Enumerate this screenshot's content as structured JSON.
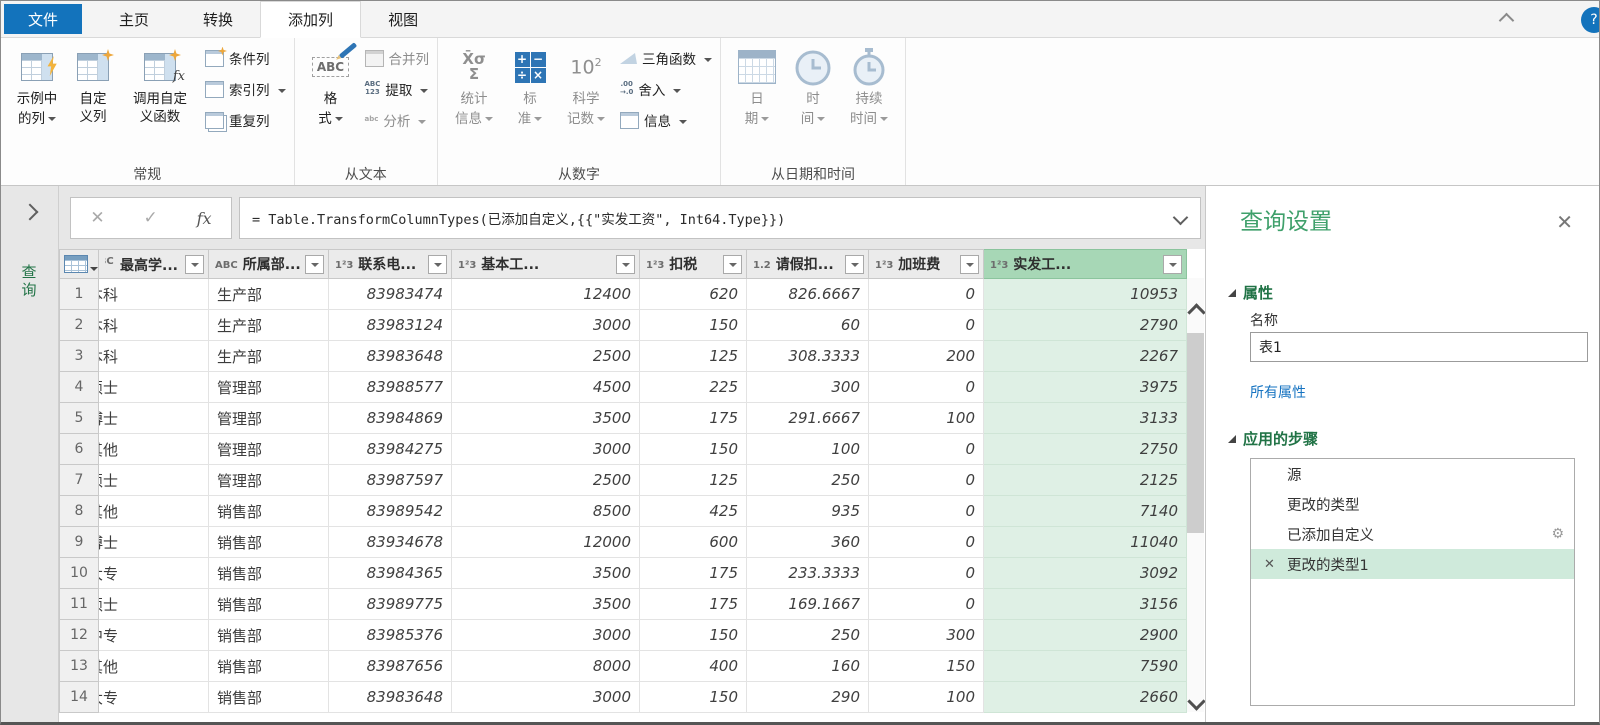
{
  "colors": {
    "tab_blue": "#1373bc",
    "panel_title_green": "#3fa06b",
    "heading_green": "#217346",
    "selected_column_header": "#a7d7b6",
    "selected_column_cell": "#dff0e5",
    "step_selected_bg": "#cfeadb",
    "link_blue": "#1673c1"
  },
  "tabs": [
    {
      "label": "文件"
    },
    {
      "label": "主页"
    },
    {
      "label": "转换"
    },
    {
      "label": "添加列"
    },
    {
      "label": "视图"
    }
  ],
  "ribbon": {
    "groups": [
      {
        "name": "常规",
        "big": [
          {
            "label": "示例中\n的列",
            "arrow": true
          },
          {
            "label": "自定\n义列",
            "arrow": false
          },
          {
            "label": "调用自定\n义函数",
            "arrow": false
          }
        ],
        "small": [
          {
            "label": "条件列",
            "arrow": false
          },
          {
            "label": "索引列",
            "arrow": true
          },
          {
            "label": "重复列",
            "arrow": false
          }
        ]
      },
      {
        "name": "从文本",
        "big": [
          {
            "label": "格\n式",
            "arrow": true
          }
        ],
        "small": [
          {
            "label": "合并列",
            "arrow": false,
            "disabled": true
          },
          {
            "label": "提取",
            "arrow": true
          },
          {
            "label": "分析",
            "arrow": true,
            "disabled": true
          }
        ]
      },
      {
        "name": "从数字",
        "big": [
          {
            "label": "统计\n信息",
            "arrow": true,
            "disabled": true
          },
          {
            "label": "标\n准",
            "arrow": true,
            "disabled": true
          },
          {
            "label": "科学\n记数",
            "arrow": true,
            "disabled": true
          }
        ],
        "small": [
          {
            "label": "三角函数",
            "arrow": true
          },
          {
            "label": "舍入",
            "arrow": true
          },
          {
            "label": "信息",
            "arrow": true
          }
        ]
      },
      {
        "name": "从日期和时间",
        "big": [
          {
            "label": "日\n期",
            "arrow": true,
            "disabled": true
          },
          {
            "label": "时\n间",
            "arrow": true,
            "disabled": true
          },
          {
            "label": "持续\n时间",
            "arrow": true,
            "disabled": true
          }
        ],
        "small": []
      }
    ]
  },
  "formula_bar": {
    "cancel": "✕",
    "check": "✓",
    "fx": "fx",
    "formula": "= Table.TransformColumnTypes(已添加自定义,{{\"实发工资\", Int64.Type}})"
  },
  "queries_pane": {
    "label": "查询"
  },
  "table": {
    "columns": [
      {
        "type_display": "ABC",
        "name": "最高学...",
        "clipped": true
      },
      {
        "type_display": "ABC",
        "name": "所属部..."
      },
      {
        "type_display": "1²3",
        "name": "联系电...",
        "numeric": true
      },
      {
        "type_display": "1²3",
        "name": "基本工...",
        "numeric": true
      },
      {
        "type_display": "1²3",
        "name": "扣税",
        "numeric": true
      },
      {
        "type_display": "1.2",
        "name": "请假扣...",
        "numeric": true
      },
      {
        "type_display": "1²3",
        "name": "加班费",
        "numeric": true
      },
      {
        "type_display": "1²3",
        "name": "实发工...",
        "numeric": true,
        "selected": true
      }
    ],
    "rows": [
      [
        "本科",
        "生产部",
        "83983474",
        "12400",
        "620",
        "826.6667",
        "0",
        "10953"
      ],
      [
        "本科",
        "生产部",
        "83983124",
        "3000",
        "150",
        "60",
        "0",
        "2790"
      ],
      [
        "本科",
        "生产部",
        "83983648",
        "2500",
        "125",
        "308.3333",
        "200",
        "2267"
      ],
      [
        "硕士",
        "管理部",
        "83988577",
        "4500",
        "225",
        "300",
        "0",
        "3975"
      ],
      [
        "博士",
        "管理部",
        "83984869",
        "3500",
        "175",
        "291.6667",
        "100",
        "3133"
      ],
      [
        "其他",
        "管理部",
        "83984275",
        "3000",
        "150",
        "100",
        "0",
        "2750"
      ],
      [
        "硕士",
        "管理部",
        "83987597",
        "2500",
        "125",
        "250",
        "0",
        "2125"
      ],
      [
        "其他",
        "销售部",
        "83989542",
        "8500",
        "425",
        "935",
        "0",
        "7140"
      ],
      [
        "博士",
        "销售部",
        "83934678",
        "12000",
        "600",
        "360",
        "0",
        "11040"
      ],
      [
        "大专",
        "销售部",
        "83984365",
        "3500",
        "175",
        "233.3333",
        "0",
        "3092"
      ],
      [
        "硕士",
        "销售部",
        "83989775",
        "3500",
        "175",
        "169.1667",
        "0",
        "3156"
      ],
      [
        "中专",
        "销售部",
        "83985376",
        "3000",
        "150",
        "250",
        "300",
        "2900"
      ],
      [
        "其他",
        "销售部",
        "83987656",
        "8000",
        "400",
        "160",
        "150",
        "7590"
      ],
      [
        "大专",
        "销售部",
        "83983648",
        "3000",
        "150",
        "290",
        "100",
        "2660"
      ]
    ]
  },
  "settings": {
    "title": "查询设置",
    "close": "✕",
    "properties_heading": "属性",
    "name_label": "名称",
    "name_value": "表1",
    "all_properties_link": "所有属性",
    "steps_heading": "应用的步骤",
    "steps": [
      {
        "label": "源"
      },
      {
        "label": "更改的类型"
      },
      {
        "label": "已添加自定义",
        "gear": true
      },
      {
        "label": "更改的类型1",
        "selected": true
      }
    ],
    "delete_step_glyph": "✕",
    "gear_glyph": "⚙"
  }
}
